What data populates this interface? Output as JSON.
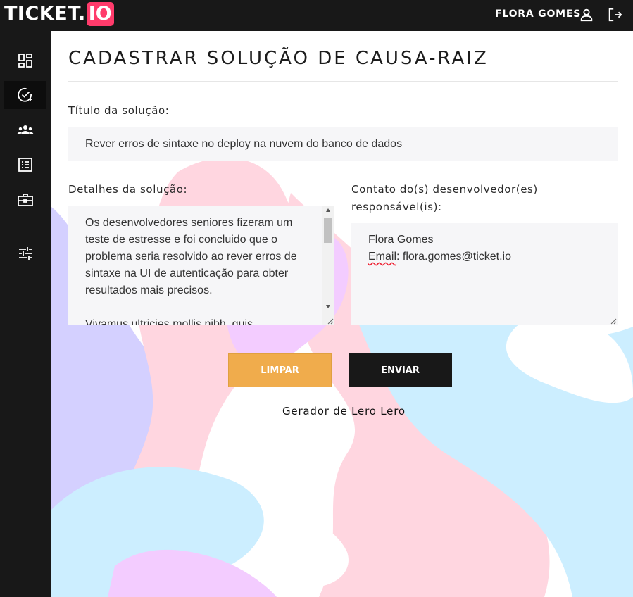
{
  "app": {
    "logo_main": "TICKET.",
    "logo_accent": "IO",
    "user_name": "FLORA GOMES"
  },
  "sidebar": {
    "items": [
      {
        "icon": "dashboard-icon",
        "active": false
      },
      {
        "icon": "check-plus-icon",
        "active": true
      },
      {
        "icon": "team-icon",
        "active": false
      },
      {
        "icon": "list-icon",
        "active": false
      },
      {
        "icon": "briefcase-icon",
        "active": false
      },
      {
        "icon": "settings-sliders-icon",
        "active": false
      }
    ]
  },
  "page": {
    "title": "CADASTRAR SOLUÇÃO DE CAUSA-RAIZ",
    "solution_title_label": "Título da solução:",
    "solution_title_value": "Rever erros de sintaxe no deploy na nuvem do banco de dados",
    "details_label": "Detalhes da solução:",
    "details_value": "Os desenvolvedores seniores fizeram um teste de estresse e foi concluido que o problema seria resolvido ao rever erros de sintaxe na UI de autenticação para obter resultados mais precisos.\n\nVivamus ultricies mollis nibh, quis",
    "contact_label_line1": "Contato do(s) desenvolvedor(es)",
    "contact_label_line2": "responsável(is):",
    "contact_name": "Flora Gomes",
    "contact_email_label": "Email",
    "contact_email_value": ": flora.gomes@ticket.io",
    "clear_button": "LIMPAR",
    "submit_button": "ENVIAR",
    "lero_link": "Gerador de Lero Lero"
  },
  "colors": {
    "brand_accent": "#ff3b6b",
    "dark": "#181818",
    "clear_button": "#f0ac4c",
    "field_bg": "#f6f6f8",
    "blob_pink": "#ffd6e0",
    "blob_lilac": "#f3ccff",
    "blob_blue": "#cceeff",
    "blob_violet": "#d4d0ff"
  }
}
